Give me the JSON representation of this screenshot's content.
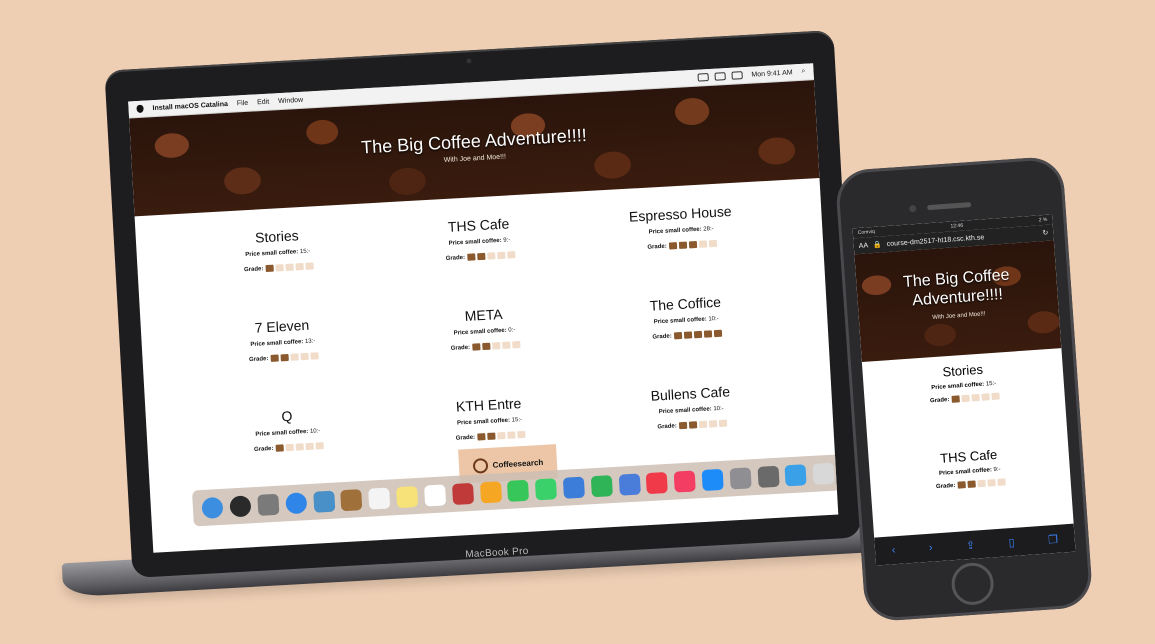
{
  "menubar": {
    "app": "Install macOS Catalina",
    "items": [
      "File",
      "Edit",
      "Window"
    ],
    "clock": "Mon 9:41 AM"
  },
  "site": {
    "title": "The Big Coffee Adventure!!!!",
    "subtitle": "With Joe and Moe!!!",
    "price_label": "Price small coffee:",
    "grade_label": "Grade:",
    "search_label": "Coffeesearch"
  },
  "cafes": [
    {
      "name": "Stories",
      "price": "15:-",
      "grade": 1
    },
    {
      "name": "THS Cafe",
      "price": "9:-",
      "grade": 2
    },
    {
      "name": "Espresso House",
      "price": "28:-",
      "grade": 3
    },
    {
      "name": "7 Eleven",
      "price": "13:-",
      "grade": 2
    },
    {
      "name": "META",
      "price": "0:-",
      "grade": 2
    },
    {
      "name": "The Coffice",
      "price": "10:-",
      "grade": 5
    },
    {
      "name": "Q",
      "price": "10:-",
      "grade": 1
    },
    {
      "name": "KTH Entre",
      "price": "15:-",
      "grade": 2
    },
    {
      "name": "Bullens Cafe",
      "price": "10:-",
      "grade": 2
    }
  ],
  "laptop": {
    "label": "MacBook Pro"
  },
  "dock_icons": [
    "finder-icon",
    "siri-icon",
    "launchpad-icon",
    "safari-icon",
    "photos-preview-icon",
    "notes-book-icon",
    "calendar-icon",
    "notes-icon",
    "reminders-icon",
    "photo-booth-icon",
    "photos-icon",
    "messages-icon",
    "facetime-icon",
    "keynote-icon",
    "numbers-icon",
    "keynote-stand-icon",
    "news-icon",
    "music-icon",
    "app-store-icon",
    "system-preferences-icon",
    "installer-icon",
    "downloads-folder-icon",
    "trash-icon"
  ],
  "dock_colors": [
    "#3c8fe0",
    "#2a2a2a",
    "#7a7a7a",
    "#2f86e8",
    "#4a90c8",
    "#a0703a",
    "#f4f4f4",
    "#f7e27a",
    "#fff",
    "#c03a3a",
    "#f5a623",
    "#37c659",
    "#3ad16a",
    "#3b7dd8",
    "#2fb457",
    "#4a7cd9",
    "#f03a4a",
    "#f43d62",
    "#1d8cf8",
    "#8e8e93",
    "#6a6a6a",
    "#3aa0e8",
    "#d8d8d8"
  ],
  "phone": {
    "carrier": "Comviq",
    "time": "12:46",
    "battery": "2 %",
    "text_size": "AA",
    "url": "course-dm2517-ht18.csc.kth.se",
    "title": "The Big Coffee Adventure!!!!",
    "subtitle": "With Joe and Moe!!!",
    "cafes": [
      {
        "name": "Stories",
        "price": "15:-",
        "grade": 1
      },
      {
        "name": "THS Cafe",
        "price": "9:-",
        "grade": 2
      }
    ],
    "toolbar": [
      "back-icon",
      "forward-icon",
      "share-icon",
      "bookmarks-icon",
      "tabs-icon"
    ],
    "toolbar_glyphs": [
      "‹",
      "›",
      "⇪",
      "▯",
      "❐"
    ]
  }
}
